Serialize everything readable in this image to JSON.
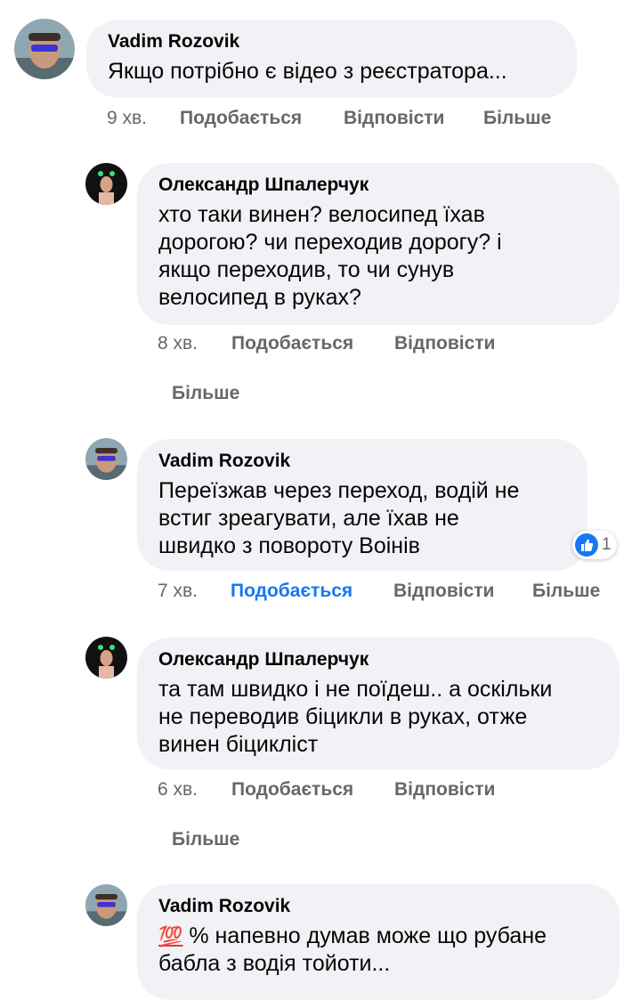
{
  "comments": [
    {
      "author": "Vadim Rozovik",
      "text": "Якщо потрібно є відео з реєстратора...",
      "time": "9 хв.",
      "like": "Подобається",
      "reply": "Відповісти",
      "more": "Більше"
    },
    {
      "author": "Олександр Шпалерчук",
      "lines": [
        "хто таки винен? велосипед їхав",
        "дорогою? чи переходив дорогу? і",
        "якщо переходив, то чи сунув",
        "велосипед в руках?"
      ],
      "time": "8 хв.",
      "like": "Подобається",
      "reply": "Відповісти",
      "more": "Більше"
    },
    {
      "author": "Vadim Rozovik",
      "lines": [
        "Переїзжав через переход, водій не",
        "встиг зреагувати, але їхав не",
        "швидко з повороту Воінів"
      ],
      "reaction_icon": "thumbs-up-icon",
      "reaction_count": "1",
      "time": "7 хв.",
      "like": "Подобається",
      "like_active": true,
      "reply": "Відповісти",
      "more": "Більше"
    },
    {
      "author": "Олександр Шпалерчук",
      "lines": [
        "та там швидко і не поїдеш.. а оскільки",
        "не переводив біцикли в руках, отже",
        "винен біцикліст"
      ],
      "time": "6 хв.",
      "like": "Подобається",
      "reply": "Відповісти",
      "more": "Більше"
    },
    {
      "author": "Vadim Rozovik",
      "emoji": "💯",
      "emoji_icon": "hundred-points-icon",
      "line1_rest": " % напевно думав може що рубане",
      "line2": "бабла з водія тойоти..."
    }
  ],
  "colors": {
    "bubble": "#f0f2f5",
    "secondary_text": "#65676b",
    "like_active": "#1877f2"
  }
}
